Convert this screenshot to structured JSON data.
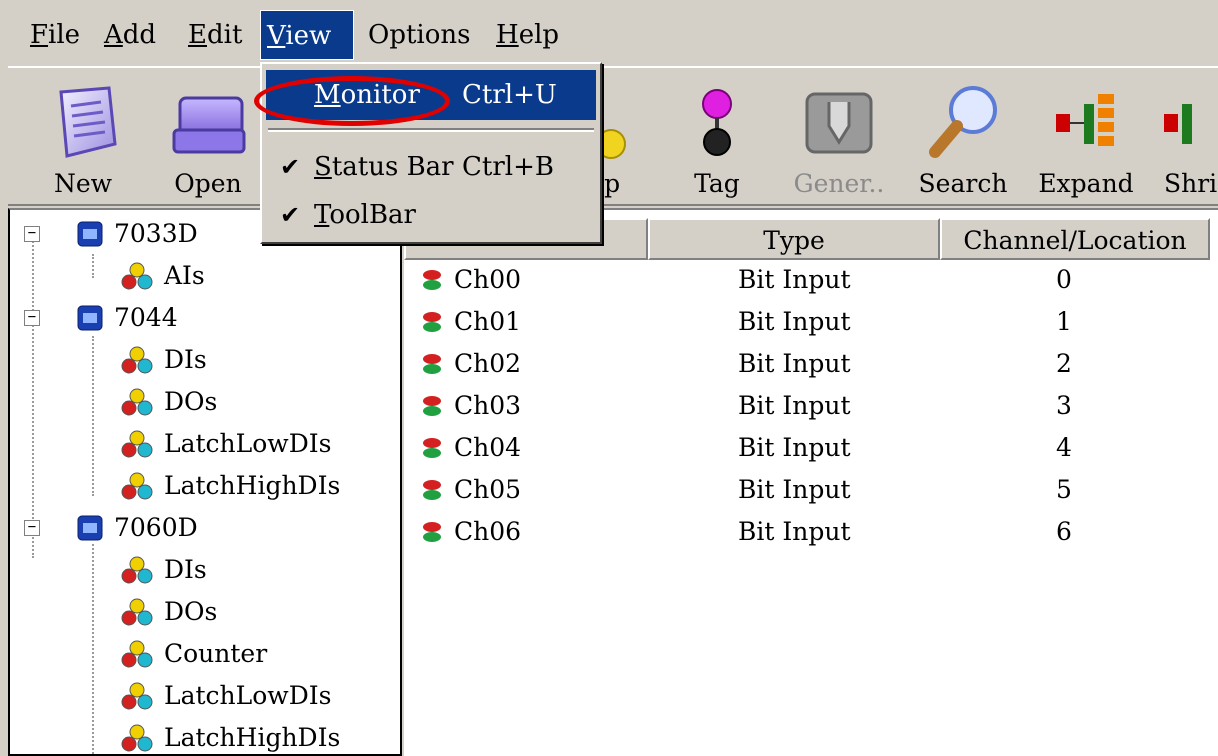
{
  "menubar": {
    "items": [
      {
        "key": "file",
        "label": "File",
        "accel": "F",
        "rest": "ile"
      },
      {
        "key": "add",
        "label": "Add",
        "accel": "A",
        "rest": "dd"
      },
      {
        "key": "edit",
        "label": "Edit",
        "accel": "E",
        "rest": "dit"
      },
      {
        "key": "view",
        "label": "View",
        "accel": "V",
        "rest": "iew"
      },
      {
        "key": "options",
        "label": "Options",
        "accel": "",
        "rest": "Options"
      },
      {
        "key": "help",
        "label": "Help",
        "accel": "H",
        "rest": "elp"
      }
    ]
  },
  "toolbar": {
    "new": "New",
    "open": "Open",
    "group": "up",
    "tag": "Tag",
    "generate": "Gener..",
    "search": "Search",
    "expand": "Expand",
    "shrink": "Shri"
  },
  "view_menu": {
    "monitor": {
      "accel": "M",
      "rest": "onitor",
      "shortcut": "Ctrl+U"
    },
    "status_bar": {
      "accel": "S",
      "rest": "tatus Bar",
      "shortcut": "Ctrl+B",
      "checked": true
    },
    "toolbar": {
      "accel": "T",
      "rest": "oolBar",
      "checked": true
    }
  },
  "tree": {
    "devices": [
      {
        "name": "7033D",
        "children": [
          "AIs"
        ]
      },
      {
        "name": "7044",
        "children": [
          "DIs",
          "DOs",
          "LatchLowDIs",
          "LatchHighDIs"
        ]
      },
      {
        "name": "7060D",
        "children": [
          "DIs",
          "DOs",
          "Counter",
          "LatchLowDIs",
          "LatchHighDIs"
        ]
      }
    ]
  },
  "list": {
    "columns": [
      "Type",
      "Channel/Location"
    ],
    "rows": [
      {
        "name": "Ch00",
        "type": "Bit Input",
        "channel": "0"
      },
      {
        "name": "Ch01",
        "type": "Bit Input",
        "channel": "1"
      },
      {
        "name": "Ch02",
        "type": "Bit Input",
        "channel": "2"
      },
      {
        "name": "Ch03",
        "type": "Bit Input",
        "channel": "3"
      },
      {
        "name": "Ch04",
        "type": "Bit Input",
        "channel": "4"
      },
      {
        "name": "Ch05",
        "type": "Bit Input",
        "channel": "5"
      },
      {
        "name": "Ch06",
        "type": "Bit Input",
        "channel": "6"
      }
    ]
  },
  "colors": {
    "highlight": "#0a3a8c",
    "annotation": "#e00000",
    "face": "#d4d0c8"
  }
}
